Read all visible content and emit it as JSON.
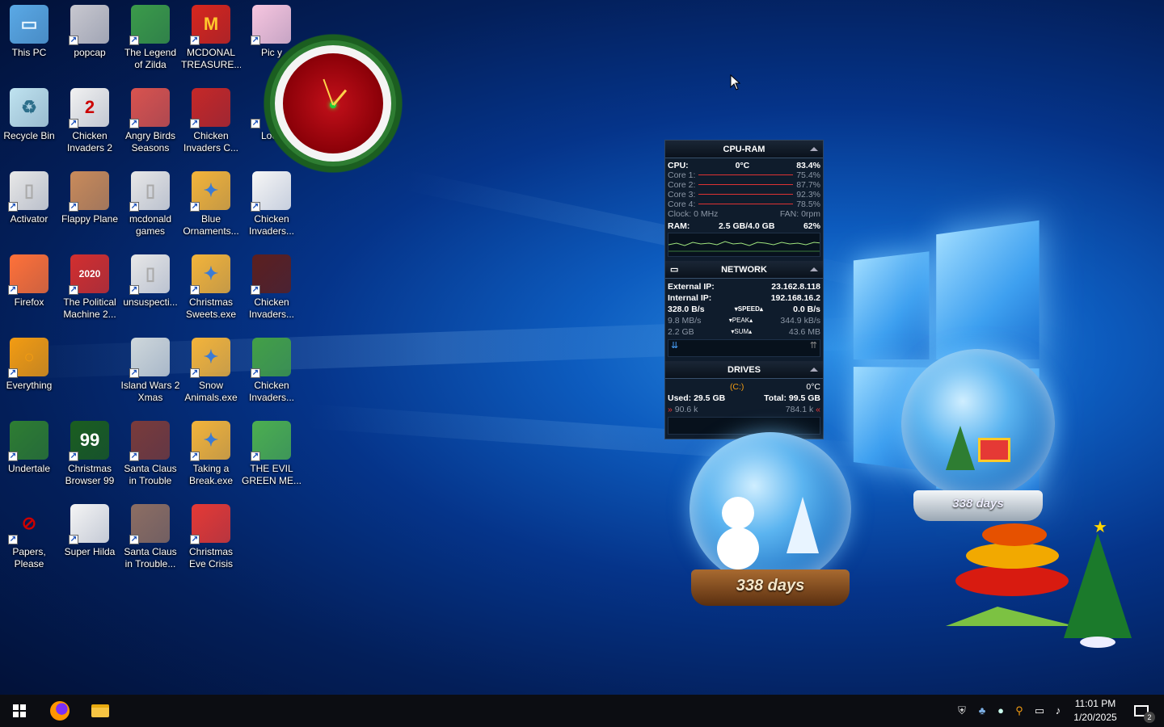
{
  "desktop": {
    "icons": [
      {
        "label": "This PC"
      },
      {
        "label": "popcap"
      },
      {
        "label": "The Legend of Zilda"
      },
      {
        "label": "MCDONAL TREASURE..."
      },
      {
        "label": "Pic y"
      },
      {
        "label": "Recycle Bin"
      },
      {
        "label": "Chicken Invaders 2"
      },
      {
        "label": "Angry Birds Seasons"
      },
      {
        "label": "Chicken Invaders C..."
      },
      {
        "label": "Loco"
      },
      {
        "label": "Activator"
      },
      {
        "label": "Flappy Plane"
      },
      {
        "label": "mcdonald games"
      },
      {
        "label": "Blue Ornaments..."
      },
      {
        "label": "Chicken Invaders..."
      },
      {
        "label": "Firefox"
      },
      {
        "label": "The Political Machine 2..."
      },
      {
        "label": "unsuspecti..."
      },
      {
        "label": "Christmas Sweets.exe"
      },
      {
        "label": "Chicken Invaders..."
      },
      {
        "label": "Everything"
      },
      {
        "label": "Island Wars 2 Xmas"
      },
      {
        "label": "Snow Animals.exe"
      },
      {
        "label": "Chicken Invaders..."
      },
      {
        "label": "Undertale"
      },
      {
        "label": "Christmas Browser 99"
      },
      {
        "label": "Santa Claus in Trouble"
      },
      {
        "label": "Taking a Break.exe"
      },
      {
        "label": "THE EVIL GREEN ME..."
      },
      {
        "label": "Papers, Please"
      },
      {
        "label": "Super Hilda"
      },
      {
        "label": "Santa Claus in Trouble..."
      },
      {
        "label": "Christmas Eve Crisis"
      }
    ],
    "icon_badges": {
      "mcdonalds": "M",
      "political": "2020",
      "browser": "99"
    }
  },
  "gadget": {
    "cpu_ram": {
      "title": "CPU-RAM",
      "cpu_label": "CPU:",
      "cpu_temp": "0°C",
      "cpu_pct": "83.4%",
      "cores": [
        {
          "label": "Core 1:",
          "value": "75.4%"
        },
        {
          "label": "Core 2:",
          "value": "87.7%"
        },
        {
          "label": "Core 3:",
          "value": "92.3%"
        },
        {
          "label": "Core 4:",
          "value": "78.5%"
        }
      ],
      "clock": "Clock: 0 MHz",
      "fan": "FAN: 0rpm",
      "ram_label": "RAM:",
      "ram_value": "2.5 GB/4.0 GB",
      "ram_pct": "62%"
    },
    "network": {
      "title": "NETWORK",
      "ext_label": "External IP:",
      "ext_ip": "23.162.8.118",
      "int_label": "Internal IP:",
      "int_ip": "192.168.16.2",
      "speed_left": "328.0 B/s",
      "speed_label": "▾SPEED▴",
      "speed_right": "0.0 B/s",
      "peak_left": "9.8 MB/s",
      "peak_label": "▾PEAK▴",
      "peak_right": "344.9 kB/s",
      "sum_left": "2.2 GB",
      "sum_label": "▾SUM▴",
      "sum_right": "43.6 MB"
    },
    "drives": {
      "title": "DRIVES",
      "drive": "(C:)",
      "temp": "0°C",
      "used": "Used: 29.5 GB",
      "total": "Total: 99.5 GB",
      "read": "90.6 k",
      "write": "784.1 k"
    }
  },
  "snowglobes": {
    "left_days": "338 days",
    "right_days": "338 days"
  },
  "taskbar": {
    "time": "11:01 PM",
    "date": "1/20/2025",
    "notifications": "2"
  }
}
